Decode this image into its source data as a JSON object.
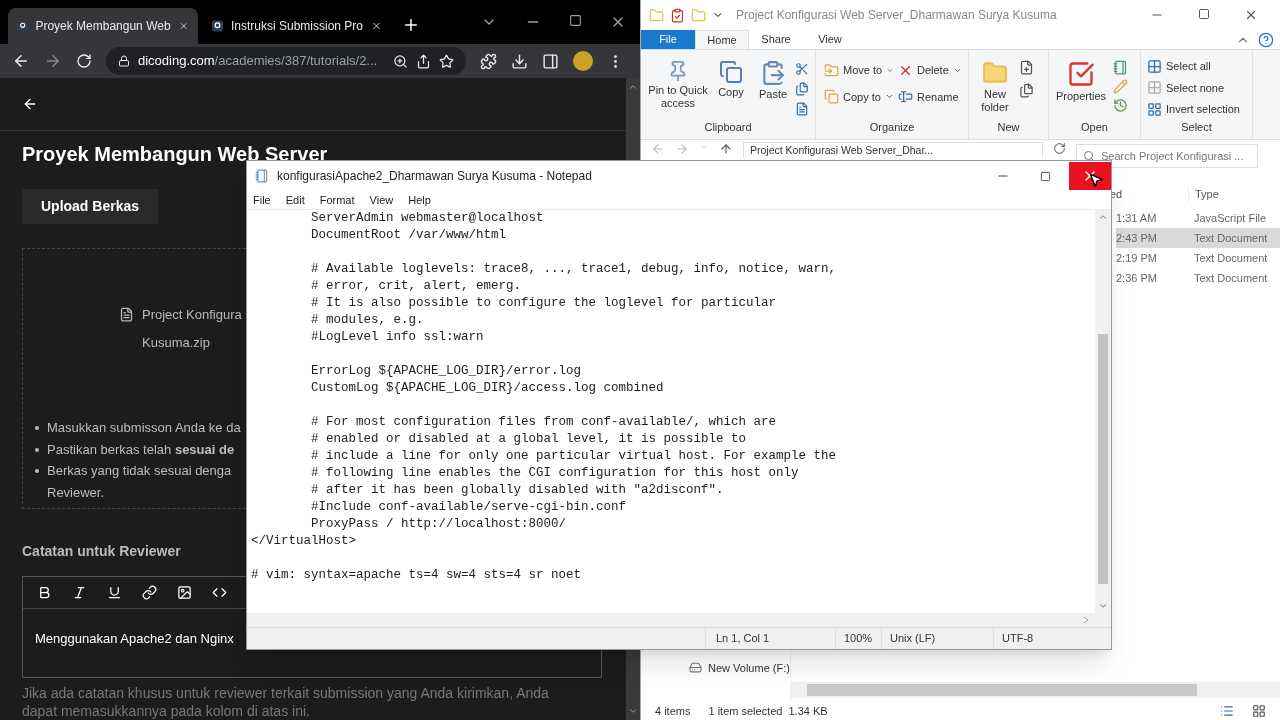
{
  "browser": {
    "tabs": [
      {
        "title": "Proyek Membangun Web",
        "selected": true
      },
      {
        "title": "Instruksi Submission Pro",
        "selected": false
      }
    ],
    "url_host": "dicoding.com",
    "url_path": "/academies/387/tutorials/2...",
    "page": {
      "title": "Proyek Membangun Web Server",
      "upload_button": "Upload Berkas",
      "file_name_lines": [
        "Project Konfigura",
        "Kusuma.zip"
      ],
      "bullets": [
        {
          "lines": [
            "Masukkan submisson Anda ke da"
          ]
        },
        {
          "lines": [
            "Pastikan berkas telah **sesuai de**"
          ]
        },
        {
          "lines": [
            "Berkas yang tidak sesuai denga",
            "Reviewer."
          ]
        }
      ],
      "notes_label": "Catatan untuk Reviewer",
      "editor_text": "Menggunakan Apache2 dan Nginx",
      "hint": "Jika ada catatan khusus untuk reviewer terkait submission yang Anda kirimkan, Anda dapat memasukkannya pada kolom di atas ini."
    }
  },
  "explorer": {
    "title": "Project Konfigurasi Web Server_Dharmawan Surya Kusuma",
    "ribbon_tabs": [
      {
        "label": "File",
        "kind": "file",
        "selected": false
      },
      {
        "label": "Home",
        "kind": "tab",
        "selected": true
      },
      {
        "label": "Share",
        "kind": "tab",
        "selected": false
      },
      {
        "label": "View",
        "kind": "tab",
        "selected": false
      }
    ],
    "ribbon": {
      "clipboard": {
        "label": "Clipboard",
        "pin": "Pin to Quick access",
        "copy": "Copy",
        "paste": "Paste"
      },
      "organize": {
        "label": "Organize",
        "move_to": "Move to",
        "copy_to": "Copy to",
        "delete": "Delete",
        "rename": "Rename"
      },
      "new": {
        "label": "New",
        "new_folder": "New folder"
      },
      "open": {
        "label": "Open",
        "properties": "Properties"
      },
      "select": {
        "label": "Select",
        "select_all": "Select all",
        "select_none": "Select none",
        "invert": "Invert selection"
      }
    },
    "address": "Project Konfigurasi Web Server_Dhar...",
    "search_placeholder": "Search Project Konfigurasi ...",
    "columns": [
      "ed",
      "Type"
    ],
    "rows": [
      {
        "modified": "1:31 AM",
        "type": "JavaScript File",
        "selected": false
      },
      {
        "modified": "2:43 PM",
        "type": "Text Document",
        "selected": true
      },
      {
        "modified": "2:19 PM",
        "type": "Text Document",
        "selected": false
      },
      {
        "modified": "2:36 PM",
        "type": "Text Document",
        "selected": false
      }
    ],
    "nav_item": "New Volume (F:)",
    "status": {
      "items": "4 items",
      "selected": "1 item selected",
      "size": "1.34 KB"
    }
  },
  "notepad": {
    "title": "konfigurasiApache2_Dharmawan Surya Kusuma - Notepad",
    "menu": [
      "File",
      "Edit",
      "Format",
      "View",
      "Help"
    ],
    "blocks": [
      [
        "        ServerAdmin webmaster@localhost",
        "        DocumentRoot /var/www/html"
      ],
      [
        "        # Available loglevels: trace8, ..., trace1, debug, info, notice, warn,",
        "        # error, crit, alert, emerg.",
        "        # It is also possible to configure the loglevel for particular",
        "        # modules, e.g.",
        "        #LogLevel info ssl:warn"
      ],
      [
        "        ErrorLog ${APACHE_LOG_DIR}/error.log",
        "        CustomLog ${APACHE_LOG_DIR}/access.log combined"
      ],
      [
        "        # For most configuration files from conf-available/, which are",
        "        # enabled or disabled at a global level, it is possible to",
        "        # include a line for only one particular virtual host. For example the",
        "        # following line enables the CGI configuration for this host only",
        "        # after it has been globally disabled with \"a2disconf\".",
        "        #Include conf-available/serve-cgi-bin.conf",
        "        ProxyPass / http://localhost:8000/",
        "</VirtualHost>"
      ],
      [
        "# vim: syntax=apache ts=4 sw=4 sts=4 sr noet"
      ]
    ],
    "status": {
      "position": "Ln 1, Col 1",
      "zoom": "100%",
      "line_endings": "Unix (LF)",
      "encoding": "UTF-8"
    }
  }
}
